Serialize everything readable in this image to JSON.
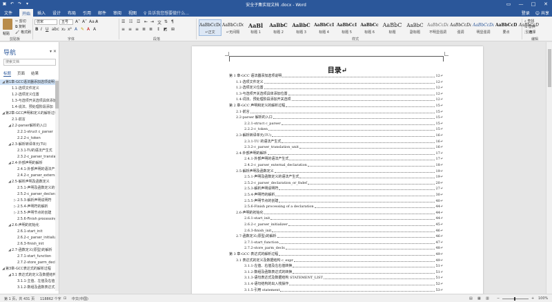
{
  "titlebar": {
    "title": "安全子集实现文档 .docx - Word",
    "min": "—",
    "max": "□",
    "close": "✕"
  },
  "tabs": {
    "items": [
      "文件",
      "开始",
      "插入",
      "设计",
      "布局",
      "引用",
      "邮件",
      "审阅",
      "视图"
    ],
    "tell_me": "♀ 告诉我您想要做什么...",
    "signin": "登录",
    "share": "共享"
  },
  "ribbon": {
    "clipboard": {
      "paste": "粘贴",
      "cut": "剪切",
      "copy": "复制",
      "format_painter": "格式刷",
      "group_label": "剪贴板"
    },
    "font": {
      "name": "仿宋",
      "size": "五号",
      "group_label": "字体",
      "bold": "B",
      "italic": "I",
      "underline": "U"
    },
    "paragraph": {
      "group_label": "段落"
    },
    "styles": {
      "group_label": "样式",
      "items": [
        {
          "sample": "AaBbCcDc",
          "name": "↵正文"
        },
        {
          "sample": "AaBbCcDc",
          "name": "↵无间隔"
        },
        {
          "sample": "AaBl",
          "name": "标题 1"
        },
        {
          "sample": "AaBbC",
          "name": "标题 2"
        },
        {
          "sample": "AaBbC",
          "name": "标题 3"
        },
        {
          "sample": "AaBbCcI",
          "name": "标题 4"
        },
        {
          "sample": "AaBbCcI",
          "name": "标题 5"
        },
        {
          "sample": "AaBbCc",
          "name": "标题 6"
        },
        {
          "sample": "AaBbC",
          "name": "标题"
        },
        {
          "sample": "AaBbC",
          "name": "副标题"
        },
        {
          "sample": "AaBbCcDa",
          "name": "不明显强调"
        },
        {
          "sample": "AaBbCcDa",
          "name": "强调"
        },
        {
          "sample": "AaBbCcDa",
          "name": "明显强调"
        },
        {
          "sample": "AaBbCcDa",
          "name": "要点"
        },
        {
          "sample": "AaBbCcD",
          "name": "引用"
        }
      ]
    },
    "editing": {
      "find": "查找",
      "replace": "替换",
      "select": "选择",
      "group_label": "编辑"
    }
  },
  "nav": {
    "title": "导航",
    "search_placeholder": "搜索文档",
    "tabs": [
      "标题",
      "页面",
      "结果"
    ],
    "items": [
      {
        "label": "第1章-GCC语法器添加选项说明",
        "level": 1,
        "tri": "◢"
      },
      {
        "label": "1.1-选项文件定义",
        "level": 2,
        "tri": ""
      },
      {
        "label": "1.2-选项定义位置",
        "level": 2,
        "tri": ""
      },
      {
        "label": "1.3-与选项开关选项具体添加",
        "level": 2,
        "tri": ""
      },
      {
        "label": "1.4-说法、预处理阶段添加",
        "level": 2,
        "tri": ""
      },
      {
        "label": "第2章-GCC声明和定义的解析过程",
        "level": 1,
        "tri": "◢"
      },
      {
        "label": "2.1-前言",
        "level": 2,
        "tri": ""
      },
      {
        "label": "2.2-parser解析的入口",
        "level": 2,
        "tri": "◢"
      },
      {
        "label": "2.2.1-struct c_parser",
        "level": 3,
        "tri": ""
      },
      {
        "label": "2.2.2-c_token",
        "level": 3,
        "tri": ""
      },
      {
        "label": "2.3-解析转译单元(TU)",
        "level": 2,
        "tri": "◢"
      },
      {
        "label": "2.3.1-TU的语法产生式",
        "level": 3,
        "tri": ""
      },
      {
        "label": "2.3.2-c_parser_translation_unit",
        "level": 3,
        "tri": ""
      },
      {
        "label": "2.4-外部声明的解析",
        "level": 2,
        "tri": "◢"
      },
      {
        "label": "2.4.1-外部声明的语法产生式",
        "level": 3,
        "tri": ""
      },
      {
        "label": "2.4.2-c_parser_external_declaration",
        "level": 3,
        "tri": ""
      },
      {
        "label": "2.5-解析声明及函数定义",
        "level": 2,
        "tri": "◢"
      },
      {
        "label": "2.5.1-声明及函数定义的语法产生式",
        "level": 3,
        "tri": ""
      },
      {
        "label": "2.5.2-c_parser_declaration",
        "level": 3,
        "tri": ""
      },
      {
        "label": "2.5.3-解析声明说明符",
        "level": 3,
        "tri": "▷"
      },
      {
        "label": "2.5.4-声明符的解析",
        "level": 3,
        "tri": "▷"
      },
      {
        "label": "2.5.5-声明节点的创建",
        "level": 3,
        "tri": "▷"
      },
      {
        "label": "2.5.6-Finish processing",
        "level": 3,
        "tri": ""
      },
      {
        "label": "2.6-声明的初始化",
        "level": 2,
        "tri": "◢"
      },
      {
        "label": "2.6.1-start_init",
        "level": 3,
        "tri": ""
      },
      {
        "label": "2.6.2-c_parser_initializer",
        "level": 3,
        "tri": ""
      },
      {
        "label": "2.6.3-finish_init",
        "level": 3,
        "tri": ""
      },
      {
        "label": "2.7-函数定义(原型)的解析",
        "level": 2,
        "tri": "◢"
      },
      {
        "label": "2.7.1-start_function",
        "level": 3,
        "tri": ""
      },
      {
        "label": "2.7.2-store_parm_decls",
        "level": 3,
        "tri": ""
      },
      {
        "label": "第3章-GCC表达式的解析过程",
        "level": 1,
        "tri": "◢"
      },
      {
        "label": "3.1 表达式的定义及数据结构",
        "level": 2,
        "tri": "◢"
      },
      {
        "label": "3.1.1-主值、左值及右值",
        "level": 3,
        "tri": ""
      },
      {
        "label": "3.1.2-数组及函数表达式",
        "level": 3,
        "tri": ""
      }
    ]
  },
  "document": {
    "toc_title": "目录↵",
    "entries": [
      {
        "text": "第 1 章-GCC 语法器添加选项说明",
        "page": "12↵",
        "level": 1
      },
      {
        "text": "1.1-选项文件定义",
        "page": "12↵",
        "level": 2
      },
      {
        "text": "1.2-选项定义位置",
        "page": "12↵",
        "level": 2
      },
      {
        "text": "1.3-与选项开关选项具体添加位置",
        "page": "12↵",
        "level": 2
      },
      {
        "text": "1.4-词法、预处理阶段添加开关选项",
        "page": "12↵",
        "level": 2
      },
      {
        "text": "第 2 章-GCC 声明和定义的解析过程",
        "page": "15↵",
        "level": 1
      },
      {
        "text": "2.1-前言",
        "page": "15↵",
        "level": 2
      },
      {
        "text": "2.2-parser 解析的入口",
        "page": "15↵",
        "level": 2
      },
      {
        "text": "2.2.1-struct c_parser",
        "page": "15↵",
        "level": 3
      },
      {
        "text": "2.2.2-c_token",
        "page": "15↵",
        "level": 3
      },
      {
        "text": "2.3-解析转译单元(TU)",
        "page": "16↵",
        "level": 2
      },
      {
        "text": "2.3.1-TU 的语法产生式",
        "page": "16↵",
        "level": 3
      },
      {
        "text": "2.3.2-c_parser_translation_unit",
        "page": "16↵",
        "level": 3
      },
      {
        "text": "2.4-外部声明的解析",
        "page": "17↵",
        "level": 2
      },
      {
        "text": "2.4.1-外部声明的语法产生式",
        "page": "17↵",
        "level": 3
      },
      {
        "text": "2.4.2-c_parser_external_declaration",
        "page": "18↵",
        "level": 3
      },
      {
        "text": "2.5-解析声明及函数定义",
        "page": "19↵",
        "level": 2
      },
      {
        "text": "2.5.1-声明及函数定义的语法产生式",
        "page": "19↵",
        "level": 3
      },
      {
        "text": "2.5.2-c_parser_declaration_or_fndef",
        "page": "20↵",
        "level": 3
      },
      {
        "text": "2.5.3-解析声明说明符",
        "page": "27↵",
        "level": 3
      },
      {
        "text": "2.5.4-声明符的解析",
        "page": "30↵",
        "level": 3
      },
      {
        "text": "2.5.5-声明节点的创建",
        "page": "40↵",
        "level": 3
      },
      {
        "text": "2.5.6-Finish processing of a declaration",
        "page": "44↵",
        "level": 3
      },
      {
        "text": "2.6-声明的初始化",
        "page": "44↵",
        "level": 2
      },
      {
        "text": "2.6.1-start_init",
        "page": "44↵",
        "level": 3
      },
      {
        "text": "2.6.2-c_parser_initializer",
        "page": "45↵",
        "level": 3
      },
      {
        "text": "2.6.3-finish_init",
        "page": "46↵",
        "level": 3
      },
      {
        "text": "2.7-函数定义(原型)的解析",
        "page": "46↵",
        "level": 2
      },
      {
        "text": "2.7.1-start_function",
        "page": "47↵",
        "level": 3
      },
      {
        "text": "2.7.2-store_parm_decls",
        "page": "48↵",
        "level": 3
      },
      {
        "text": "第 3 章-GCC 表达式的解析过程",
        "page": "49↵",
        "level": 1
      },
      {
        "text": "3.1 表达式的定义及数据结构 c_expr",
        "page": "49↵",
        "level": 2
      },
      {
        "text": "3.1.1-左值、右值及左右值转换",
        "page": "51↵",
        "level": 3
      },
      {
        "text": "3.1.2-数组及函数表达式的转换",
        "page": "51↵",
        "level": 3
      },
      {
        "text": "3.1.3-语句表达式及数据结构 STATEMENT_LIST",
        "page": "51↵",
        "level": 3
      },
      {
        "text": "3.1.4-语句结构的出入栈操作",
        "page": "52↵",
        "level": 3
      },
      {
        "text": "3.1.5-引用 statement",
        "page": "53↵",
        "level": 3
      }
    ]
  },
  "status": {
    "page": "第 1 页，共 431 页",
    "words": "118862 个字",
    "language": "中文(中国)",
    "zoom": "100%"
  }
}
